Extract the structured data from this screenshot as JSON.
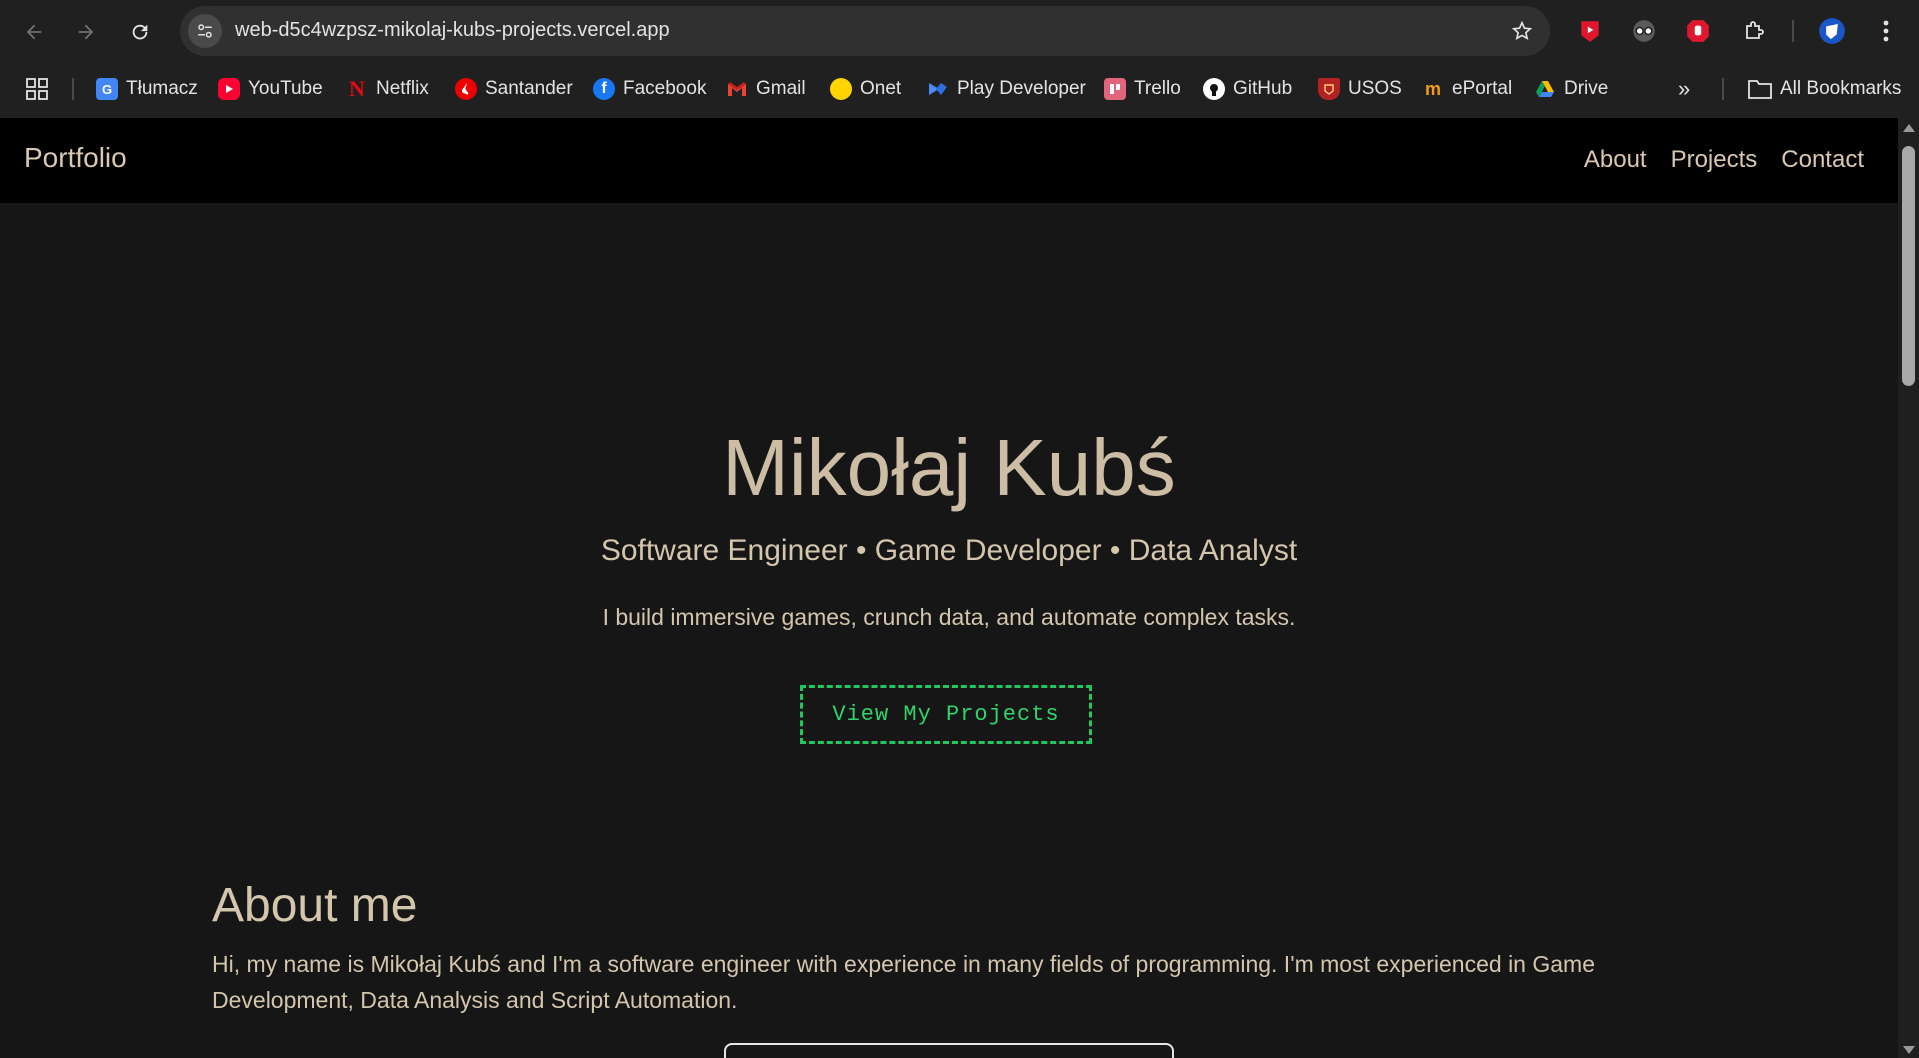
{
  "browser": {
    "url": "web-d5c4wzpsz-mikolaj-kubs-projects.vercel.app",
    "bookmarks": [
      {
        "label": "Tłumacz",
        "icon": "google-translate-icon",
        "color": "#4285f4"
      },
      {
        "label": "YouTube",
        "icon": "youtube-icon",
        "color": "#ff0033"
      },
      {
        "label": "Netflix",
        "icon": "netflix-icon",
        "color": "#e50914"
      },
      {
        "label": "Santander",
        "icon": "santander-icon",
        "color": "#ec0000"
      },
      {
        "label": "Facebook",
        "icon": "facebook-icon",
        "color": "#1877f2"
      },
      {
        "label": "Gmail",
        "icon": "gmail-icon",
        "color": "#ea4335"
      },
      {
        "label": "Onet",
        "icon": "onet-icon",
        "color": "#ffd400"
      },
      {
        "label": "Play Developer",
        "icon": "play-console-icon",
        "color": "#4c8bf5"
      },
      {
        "label": "Trello",
        "icon": "trello-icon",
        "color": "#e2657c"
      },
      {
        "label": "GitHub",
        "icon": "github-icon",
        "color": "#ffffff"
      },
      {
        "label": "USOS",
        "icon": "usos-icon",
        "color": "#b22222"
      },
      {
        "label": "ePortal",
        "icon": "eportal-icon",
        "color": "#f39c12"
      },
      {
        "label": "Drive",
        "icon": "google-drive-icon",
        "color": "#34a853"
      }
    ],
    "all_bookmarks_label": "All Bookmarks",
    "overflow_label": "»"
  },
  "site": {
    "brand": "Portfolio",
    "nav": [
      "About",
      "Projects",
      "Contact"
    ]
  },
  "hero": {
    "name": "Mikołaj Kubś",
    "roles": "Software Engineer • Game Developer • Data Analyst",
    "tagline": "I build immersive games, crunch data, and automate complex tasks.",
    "cta": "View My Projects"
  },
  "about": {
    "title": "About me",
    "text": "Hi, my name is Mikołaj Kubś and I'm a software engineer with experience in many fields of programming. I'm most experienced in Game Development, Data Analysis and Script Automation."
  },
  "colors": {
    "accent": "#22c55e",
    "text": "#d4c5ad",
    "background": "#161616",
    "navbar": "#000000"
  }
}
